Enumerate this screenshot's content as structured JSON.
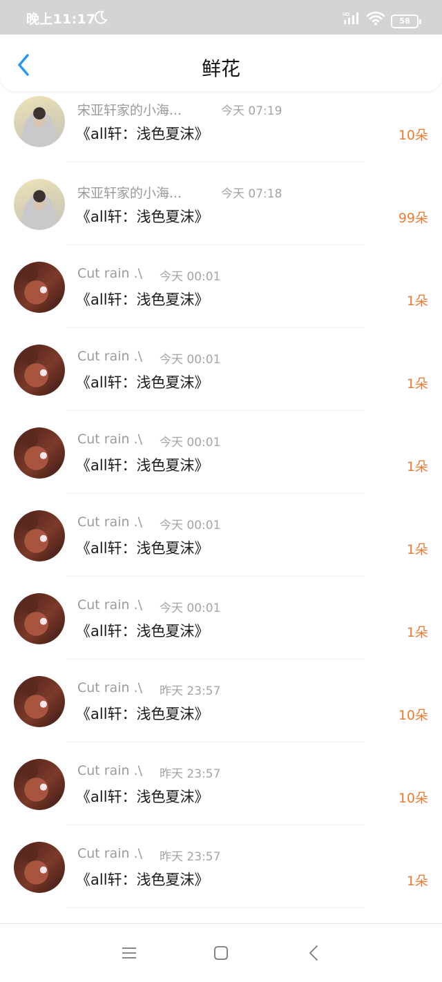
{
  "status_bar": {
    "time": "晚上11:17",
    "battery": "58",
    "icons": [
      "moon-icon",
      "hd-signal-icon",
      "wifi-icon",
      "battery-icon"
    ]
  },
  "header": {
    "title": "鲜花",
    "back_icon": "chevron-left-icon",
    "accent_color": "#2196f3"
  },
  "list": {
    "items": [
      {
        "name": "宋亚轩家的小海...",
        "time": "今天 07:19",
        "title": "《all轩：浅色夏沫》",
        "count": "10朵",
        "avatar": "a"
      },
      {
        "name": "宋亚轩家的小海...",
        "time": "今天 07:18",
        "title": "《all轩：浅色夏沫》",
        "count": "99朵",
        "avatar": "a"
      },
      {
        "name": "Cut rain .\\",
        "time": "今天 00:01",
        "title": "《all轩：浅色夏沫》",
        "count": "1朵",
        "avatar": "b"
      },
      {
        "name": "Cut rain .\\",
        "time": "今天 00:01",
        "title": "《all轩：浅色夏沫》",
        "count": "1朵",
        "avatar": "b"
      },
      {
        "name": "Cut rain .\\",
        "time": "今天 00:01",
        "title": "《all轩：浅色夏沫》",
        "count": "1朵",
        "avatar": "b"
      },
      {
        "name": "Cut rain .\\",
        "time": "今天 00:01",
        "title": "《all轩：浅色夏沫》",
        "count": "1朵",
        "avatar": "b"
      },
      {
        "name": "Cut rain .\\",
        "time": "今天 00:01",
        "title": "《all轩：浅色夏沫》",
        "count": "1朵",
        "avatar": "b"
      },
      {
        "name": "Cut rain .\\",
        "time": "昨天 23:57",
        "title": "《all轩：浅色夏沫》",
        "count": "10朵",
        "avatar": "b"
      },
      {
        "name": "Cut rain .\\",
        "time": "昨天 23:57",
        "title": "《all轩：浅色夏沫》",
        "count": "10朵",
        "avatar": "b"
      },
      {
        "name": "Cut rain .\\",
        "time": "昨天 23:57",
        "title": "《all轩：浅色夏沫》",
        "count": "1朵",
        "avatar": "b"
      },
      {
        "name": "",
        "time": "",
        "title": "",
        "count": "",
        "avatar": "b"
      }
    ]
  },
  "colors": {
    "count": "#ec7c32",
    "meta_text": "#9a9a9a",
    "status_bar_bg": "#d4d4d4"
  },
  "bottom_nav": {
    "icons": [
      "menu-icon",
      "home-square-icon",
      "back-triangle-icon"
    ]
  }
}
